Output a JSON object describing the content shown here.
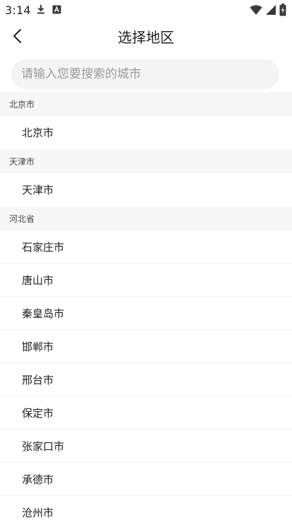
{
  "status_bar": {
    "time": "3:14",
    "left_icons": [
      "download-icon",
      "font-app-icon"
    ],
    "right_icons": [
      "wifi-icon",
      "cell-signal-icon",
      "battery-charging-icon"
    ]
  },
  "header": {
    "title": "选择地区",
    "back_icon": "chevron-left-icon"
  },
  "search": {
    "value": "",
    "placeholder": "请输入您要搜索的城市"
  },
  "sections": [
    {
      "header": "北京市",
      "cities": [
        "北京市"
      ]
    },
    {
      "header": "天津市",
      "cities": [
        "天津市"
      ]
    },
    {
      "header": "河北省",
      "cities": [
        "石家庄市",
        "唐山市",
        "秦皇岛市",
        "邯郸市",
        "邢台市",
        "保定市",
        "张家口市",
        "承德市",
        "沧州市"
      ]
    }
  ],
  "colors": {
    "section_bg": "#f7f7f7",
    "search_bg": "#f4f4f4",
    "text": "#222222",
    "placeholder": "#9a9a9a"
  }
}
